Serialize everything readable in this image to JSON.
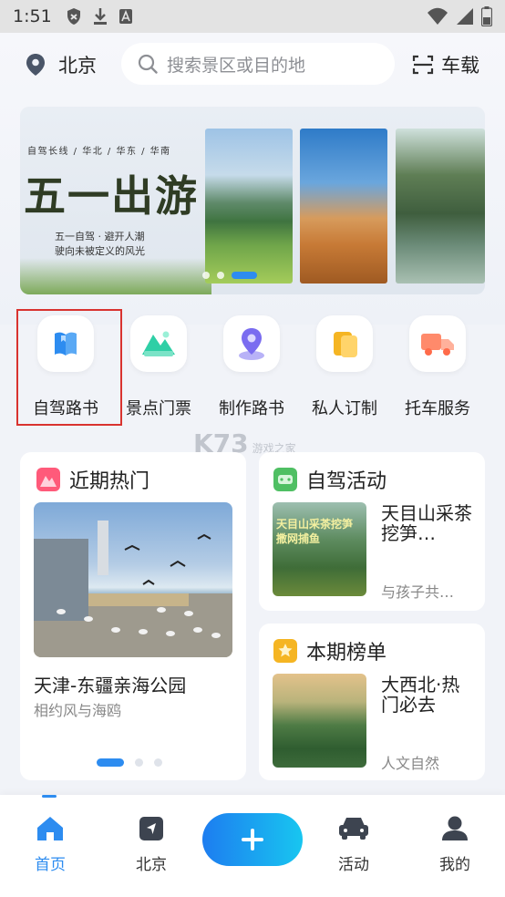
{
  "status": {
    "time": "1:51"
  },
  "header": {
    "location": "北京",
    "search_placeholder": "搜索景区或目的地",
    "scan_label": "车载"
  },
  "banner": {
    "subtitle": "自驾长线 / 华北 / 华东 / 华南",
    "title": "五一出游",
    "tagline1": "五一自驾 · 避开人潮",
    "tagline2": "驶向未被定义的风光"
  },
  "services": [
    {
      "label": "自驾路书",
      "icon": "book-icon",
      "color": "#2d8cf0"
    },
    {
      "label": "景点门票",
      "icon": "mountain-ticket-icon",
      "color": "#2ecfa6"
    },
    {
      "label": "制作路书",
      "icon": "map-pin-icon",
      "color": "#7a6cf0"
    },
    {
      "label": "私人订制",
      "icon": "custom-card-icon",
      "color": "#f5b523"
    },
    {
      "label": "托车服务",
      "icon": "truck-icon",
      "color": "#ff7b5c"
    }
  ],
  "watermark": {
    "big": "K73",
    "small": "游戏之家"
  },
  "hot": {
    "title": "近期热门",
    "place": "天津-东疆亲海公园",
    "sub": "相约风与海鸥",
    "carousel_index": 1
  },
  "activity": {
    "title": "自驾活动",
    "text": "天目山采茶挖笋…",
    "sub": "与孩子共…",
    "image_text": "天目山采茶挖笋 撒网捕鱼"
  },
  "rank": {
    "title": "本期榜单",
    "text": "大西北·热门必去",
    "sub": "人文自然"
  },
  "tabbar": {
    "home": "首页",
    "city": "北京",
    "activity": "活动",
    "mine": "我的"
  },
  "colors": {
    "accent": "#2d8cf0",
    "highlight_border": "#d9332f"
  }
}
